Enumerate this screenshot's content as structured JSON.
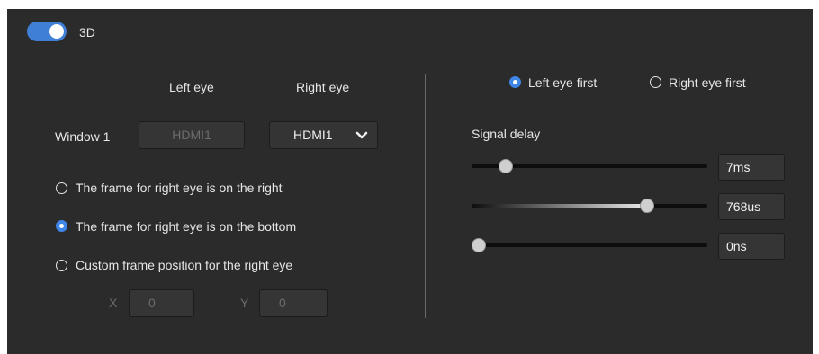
{
  "mode_toggle": {
    "label": "3D",
    "on": true
  },
  "eye_headers": {
    "left": "Left eye",
    "right": "Right eye"
  },
  "window_row": {
    "label": "Window 1",
    "left_source": "HDMI1",
    "right_source": "HDMI1"
  },
  "frame_options": [
    {
      "label": "The frame for right eye is on the right",
      "checked": false
    },
    {
      "label": "The frame for right eye is on the bottom",
      "checked": true
    },
    {
      "label": "Custom frame position for the right eye",
      "checked": false
    }
  ],
  "custom_position": {
    "x_label": "X",
    "x_value": "0",
    "y_label": "Y",
    "y_value": "0"
  },
  "eye_order": [
    {
      "label": "Left eye first",
      "checked": true
    },
    {
      "label": "Right eye first",
      "checked": false
    }
  ],
  "signal_delay": {
    "label": "Signal delay",
    "sliders": [
      {
        "value_text": "7ms",
        "level": 0.13
      },
      {
        "value_text": "768us",
        "level": 0.75
      },
      {
        "value_text": "0ns",
        "level": 0.0
      }
    ]
  },
  "colors": {
    "accent": "#3f86e8",
    "panel": "#2b2b2b",
    "background": "#ffffff"
  },
  "icons": {
    "dropdown": "chevron-down-icon"
  }
}
